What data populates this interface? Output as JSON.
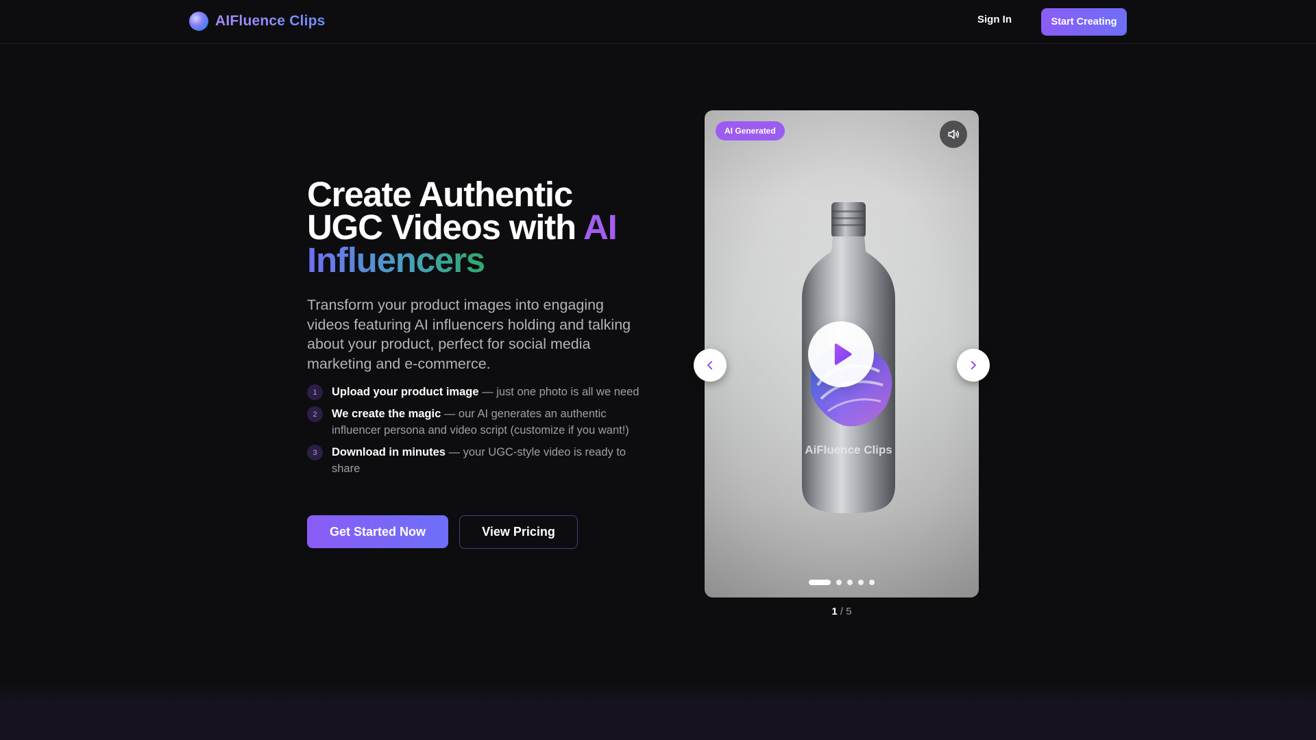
{
  "header": {
    "brand": "AIFluence Clips",
    "sign_in": "Sign In",
    "start_creating": "Start Creating"
  },
  "hero": {
    "title_line1": "Create Authentic",
    "title_line2_a": "UGC Videos with ",
    "title_line2_b": "AI",
    "title_line3": "Influencers",
    "subtitle": "Transform your product images into engaging videos featuring AI influencers holding and talking about your product, perfect for social media marketing and e-commerce.",
    "steps": [
      {
        "num": "1",
        "title": "Upload your product image",
        "desc": " — just one photo is all we need"
      },
      {
        "num": "2",
        "title": "We create the magic",
        "desc": " — our AI generates an authentic influencer persona and video script (customize if you want!)"
      },
      {
        "num": "3",
        "title": "Download in minutes",
        "desc": " — your UGC-style video is ready to share"
      }
    ],
    "primary_cta": "Get Started Now",
    "secondary_cta": "View Pricing"
  },
  "carousel": {
    "badge": "AI Generated",
    "product_label": "AiFluence Clips",
    "current": "1",
    "separator": " / ",
    "total": "5",
    "active_index": 0,
    "slide_count": 5,
    "icons": {
      "sound": "volume-icon",
      "play": "play-icon",
      "prev": "chevron-left-icon",
      "next": "chevron-right-icon"
    }
  },
  "colors": {
    "background": "#0d0d0f",
    "accent_purple": "#8b5cf6",
    "accent_blue": "#6d6ff7",
    "gradient_green": "#30a86a"
  }
}
